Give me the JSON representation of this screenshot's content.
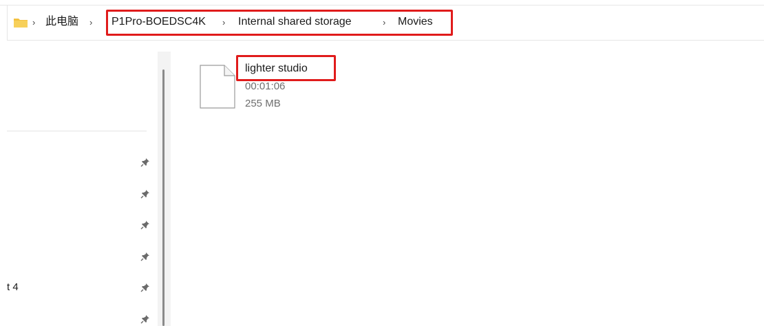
{
  "breadcrumb": {
    "items": [
      {
        "label": "此电脑"
      },
      {
        "label": "P1Pro-BOEDSC4K"
      },
      {
        "label": "Internal shared storage"
      },
      {
        "label": "Movies"
      }
    ],
    "separator": "›"
  },
  "nav": {
    "partial_item_label": "t 4",
    "pinned_count": 6
  },
  "files": [
    {
      "name": "lighter studio",
      "duration": "00:01:06",
      "size": "255 MB",
      "icon": "generic-file-icon"
    }
  ],
  "colors": {
    "highlight": "#e01b1b",
    "folder": "#f3c140",
    "text": "#1a1a1a",
    "meta_text": "#6e6e6e"
  }
}
